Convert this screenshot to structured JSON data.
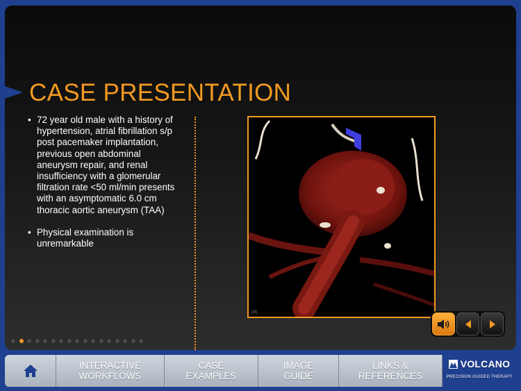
{
  "page": {
    "title": "CASE PRESENTATION",
    "bullets": [
      "72 year old male with a history of hypertension, atrial fibrillation s/p post pacemaker implantation, previous open abdominal aneurysm repair, and renal insufficiency with a glomerular filtration rate <50 ml/min presents with an asymptomatic 6.0 cm thoracic aortic aneurysm (TAA)",
      "Physical examination is unremarkable"
    ],
    "image_icon": "aorta-ct-3d-reconstruction"
  },
  "pagination": {
    "total": 17,
    "current": 2
  },
  "controls": {
    "sound_icon": "speaker-icon",
    "prev_icon": "left-arrow-icon",
    "next_icon": "right-arrow-icon"
  },
  "nav": {
    "home_icon": "home-icon",
    "items": [
      {
        "line1": "INTERACTIVE",
        "line2": "WORKFLOWS"
      },
      {
        "line1": "CASE",
        "line2": "EXAMPLES"
      },
      {
        "line1": "IMAGE",
        "line2": "GUIDE"
      },
      {
        "line1": "LINKS &",
        "line2": "REFERENCES"
      }
    ],
    "logo": {
      "name": "VOLCANO",
      "tagline": "PRECISION GUIDED THERAPY"
    }
  },
  "colors": {
    "accent": "#f29a22",
    "brand_blue": "#1f3f8f"
  }
}
